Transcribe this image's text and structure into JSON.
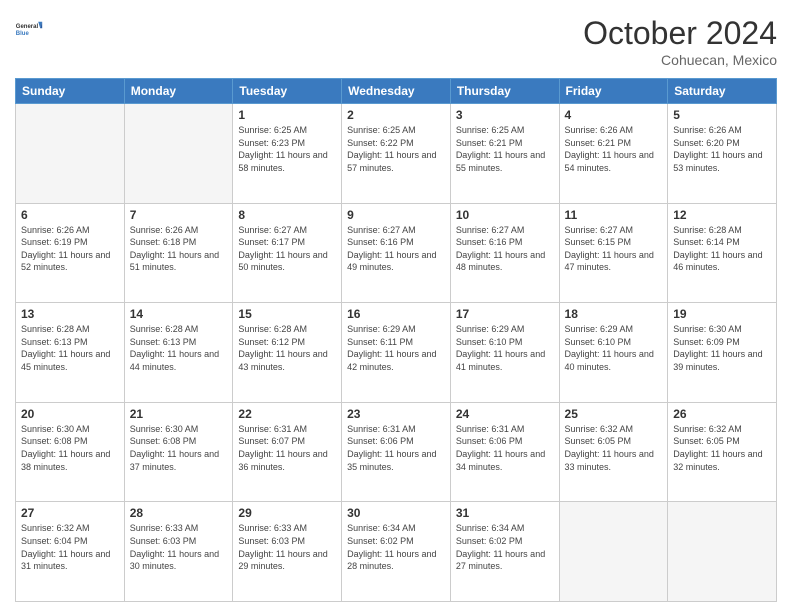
{
  "header": {
    "logo_line1": "General",
    "logo_line2": "Blue",
    "month_year": "October 2024",
    "location": "Cohuecan, Mexico"
  },
  "weekdays": [
    "Sunday",
    "Monday",
    "Tuesday",
    "Wednesday",
    "Thursday",
    "Friday",
    "Saturday"
  ],
  "weeks": [
    [
      {
        "day": "",
        "sunrise": "",
        "sunset": "",
        "daylight": "",
        "empty": true
      },
      {
        "day": "",
        "sunrise": "",
        "sunset": "",
        "daylight": "",
        "empty": true
      },
      {
        "day": "1",
        "sunrise": "Sunrise: 6:25 AM",
        "sunset": "Sunset: 6:23 PM",
        "daylight": "Daylight: 11 hours and 58 minutes."
      },
      {
        "day": "2",
        "sunrise": "Sunrise: 6:25 AM",
        "sunset": "Sunset: 6:22 PM",
        "daylight": "Daylight: 11 hours and 57 minutes."
      },
      {
        "day": "3",
        "sunrise": "Sunrise: 6:25 AM",
        "sunset": "Sunset: 6:21 PM",
        "daylight": "Daylight: 11 hours and 55 minutes."
      },
      {
        "day": "4",
        "sunrise": "Sunrise: 6:26 AM",
        "sunset": "Sunset: 6:21 PM",
        "daylight": "Daylight: 11 hours and 54 minutes."
      },
      {
        "day": "5",
        "sunrise": "Sunrise: 6:26 AM",
        "sunset": "Sunset: 6:20 PM",
        "daylight": "Daylight: 11 hours and 53 minutes."
      }
    ],
    [
      {
        "day": "6",
        "sunrise": "Sunrise: 6:26 AM",
        "sunset": "Sunset: 6:19 PM",
        "daylight": "Daylight: 11 hours and 52 minutes."
      },
      {
        "day": "7",
        "sunrise": "Sunrise: 6:26 AM",
        "sunset": "Sunset: 6:18 PM",
        "daylight": "Daylight: 11 hours and 51 minutes."
      },
      {
        "day": "8",
        "sunrise": "Sunrise: 6:27 AM",
        "sunset": "Sunset: 6:17 PM",
        "daylight": "Daylight: 11 hours and 50 minutes."
      },
      {
        "day": "9",
        "sunrise": "Sunrise: 6:27 AM",
        "sunset": "Sunset: 6:16 PM",
        "daylight": "Daylight: 11 hours and 49 minutes."
      },
      {
        "day": "10",
        "sunrise": "Sunrise: 6:27 AM",
        "sunset": "Sunset: 6:16 PM",
        "daylight": "Daylight: 11 hours and 48 minutes."
      },
      {
        "day": "11",
        "sunrise": "Sunrise: 6:27 AM",
        "sunset": "Sunset: 6:15 PM",
        "daylight": "Daylight: 11 hours and 47 minutes."
      },
      {
        "day": "12",
        "sunrise": "Sunrise: 6:28 AM",
        "sunset": "Sunset: 6:14 PM",
        "daylight": "Daylight: 11 hours and 46 minutes."
      }
    ],
    [
      {
        "day": "13",
        "sunrise": "Sunrise: 6:28 AM",
        "sunset": "Sunset: 6:13 PM",
        "daylight": "Daylight: 11 hours and 45 minutes."
      },
      {
        "day": "14",
        "sunrise": "Sunrise: 6:28 AM",
        "sunset": "Sunset: 6:13 PM",
        "daylight": "Daylight: 11 hours and 44 minutes."
      },
      {
        "day": "15",
        "sunrise": "Sunrise: 6:28 AM",
        "sunset": "Sunset: 6:12 PM",
        "daylight": "Daylight: 11 hours and 43 minutes."
      },
      {
        "day": "16",
        "sunrise": "Sunrise: 6:29 AM",
        "sunset": "Sunset: 6:11 PM",
        "daylight": "Daylight: 11 hours and 42 minutes."
      },
      {
        "day": "17",
        "sunrise": "Sunrise: 6:29 AM",
        "sunset": "Sunset: 6:10 PM",
        "daylight": "Daylight: 11 hours and 41 minutes."
      },
      {
        "day": "18",
        "sunrise": "Sunrise: 6:29 AM",
        "sunset": "Sunset: 6:10 PM",
        "daylight": "Daylight: 11 hours and 40 minutes."
      },
      {
        "day": "19",
        "sunrise": "Sunrise: 6:30 AM",
        "sunset": "Sunset: 6:09 PM",
        "daylight": "Daylight: 11 hours and 39 minutes."
      }
    ],
    [
      {
        "day": "20",
        "sunrise": "Sunrise: 6:30 AM",
        "sunset": "Sunset: 6:08 PM",
        "daylight": "Daylight: 11 hours and 38 minutes."
      },
      {
        "day": "21",
        "sunrise": "Sunrise: 6:30 AM",
        "sunset": "Sunset: 6:08 PM",
        "daylight": "Daylight: 11 hours and 37 minutes."
      },
      {
        "day": "22",
        "sunrise": "Sunrise: 6:31 AM",
        "sunset": "Sunset: 6:07 PM",
        "daylight": "Daylight: 11 hours and 36 minutes."
      },
      {
        "day": "23",
        "sunrise": "Sunrise: 6:31 AM",
        "sunset": "Sunset: 6:06 PM",
        "daylight": "Daylight: 11 hours and 35 minutes."
      },
      {
        "day": "24",
        "sunrise": "Sunrise: 6:31 AM",
        "sunset": "Sunset: 6:06 PM",
        "daylight": "Daylight: 11 hours and 34 minutes."
      },
      {
        "day": "25",
        "sunrise": "Sunrise: 6:32 AM",
        "sunset": "Sunset: 6:05 PM",
        "daylight": "Daylight: 11 hours and 33 minutes."
      },
      {
        "day": "26",
        "sunrise": "Sunrise: 6:32 AM",
        "sunset": "Sunset: 6:05 PM",
        "daylight": "Daylight: 11 hours and 32 minutes."
      }
    ],
    [
      {
        "day": "27",
        "sunrise": "Sunrise: 6:32 AM",
        "sunset": "Sunset: 6:04 PM",
        "daylight": "Daylight: 11 hours and 31 minutes."
      },
      {
        "day": "28",
        "sunrise": "Sunrise: 6:33 AM",
        "sunset": "Sunset: 6:03 PM",
        "daylight": "Daylight: 11 hours and 30 minutes."
      },
      {
        "day": "29",
        "sunrise": "Sunrise: 6:33 AM",
        "sunset": "Sunset: 6:03 PM",
        "daylight": "Daylight: 11 hours and 29 minutes."
      },
      {
        "day": "30",
        "sunrise": "Sunrise: 6:34 AM",
        "sunset": "Sunset: 6:02 PM",
        "daylight": "Daylight: 11 hours and 28 minutes."
      },
      {
        "day": "31",
        "sunrise": "Sunrise: 6:34 AM",
        "sunset": "Sunset: 6:02 PM",
        "daylight": "Daylight: 11 hours and 27 minutes."
      },
      {
        "day": "",
        "sunrise": "",
        "sunset": "",
        "daylight": "",
        "empty": true
      },
      {
        "day": "",
        "sunrise": "",
        "sunset": "",
        "daylight": "",
        "empty": true
      }
    ]
  ]
}
